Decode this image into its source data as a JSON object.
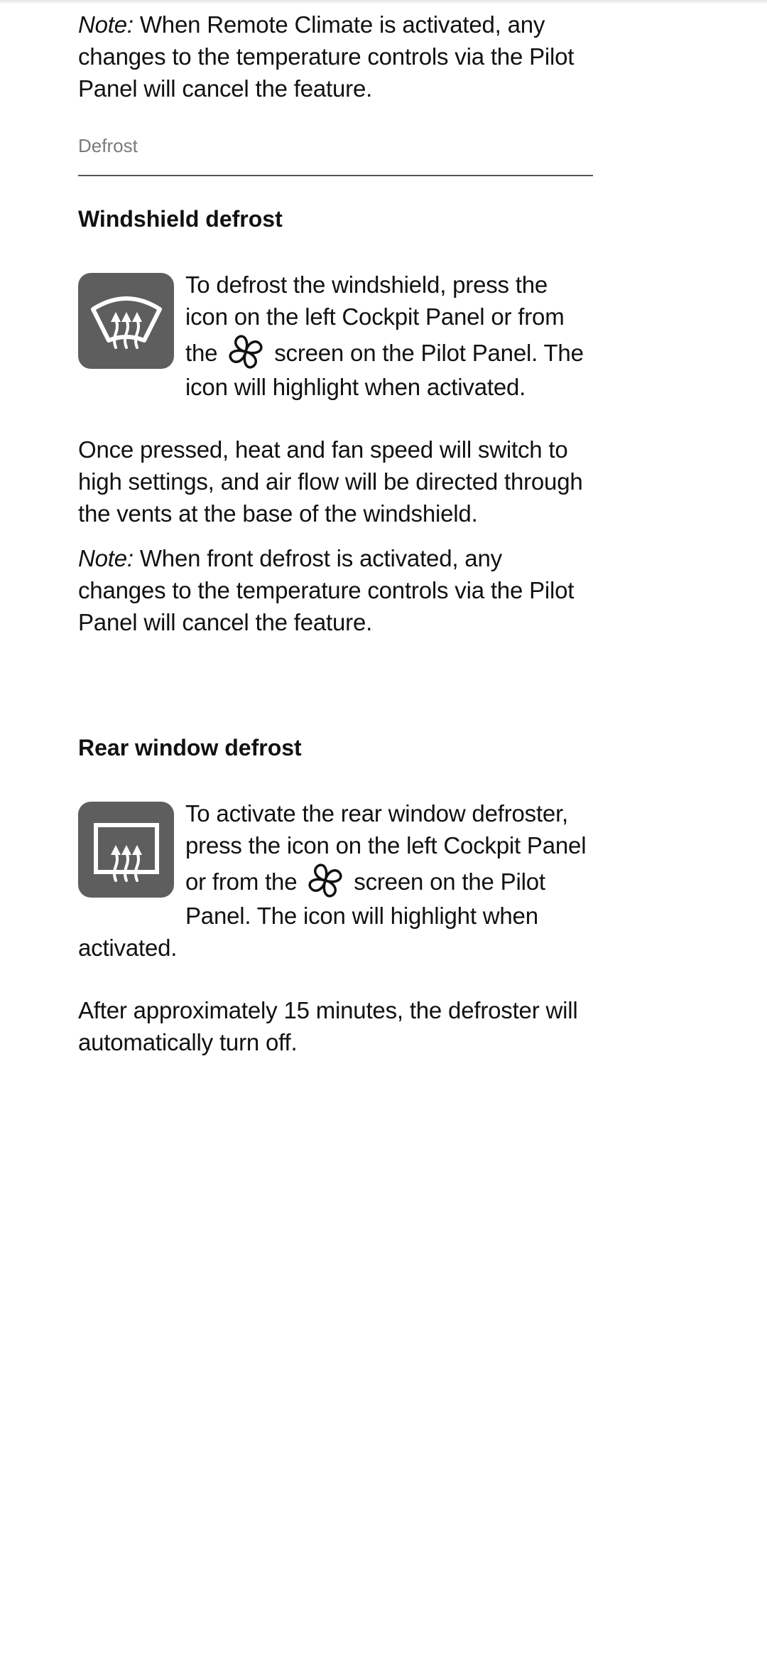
{
  "intro_note": {
    "label": "Note:",
    "text": " When Remote Climate is activated, any changes to the temperature controls via the Pilot Panel will cancel the feature."
  },
  "section": {
    "label": "Defrost"
  },
  "windshield": {
    "heading": "Windshield defrost",
    "icon": "windshield-defrost-icon",
    "para1_before": "To defrost the windshield, press the icon on the left Cockpit Panel or from the",
    "inline_icon": "fan-icon",
    "para1_after": "screen on the Pilot Panel. The icon will highlight when activated.",
    "para2": "Once pressed, heat and fan speed will switch to high settings, and air flow will be directed through the vents at the base of the windshield.",
    "note_label": "Note:",
    "note_text": " When front defrost is activated, any changes to the temperature controls via the Pilot Panel will cancel the feature."
  },
  "rear": {
    "heading": "Rear window defrost",
    "icon": "rear-defrost-icon",
    "para1_before": "To activate the rear window defroster, press the icon on the left Cockpit Panel or from the",
    "inline_icon": "fan-icon",
    "para1_after": "screen on the Pilot Panel. The icon will highlight when activated.",
    "para2": "After approximately 15 minutes, the defroster will automatically turn off."
  },
  "colors": {
    "icon_tile": "#5e5e5e",
    "section_label": "#7a7a7a",
    "divider": "#555555"
  }
}
